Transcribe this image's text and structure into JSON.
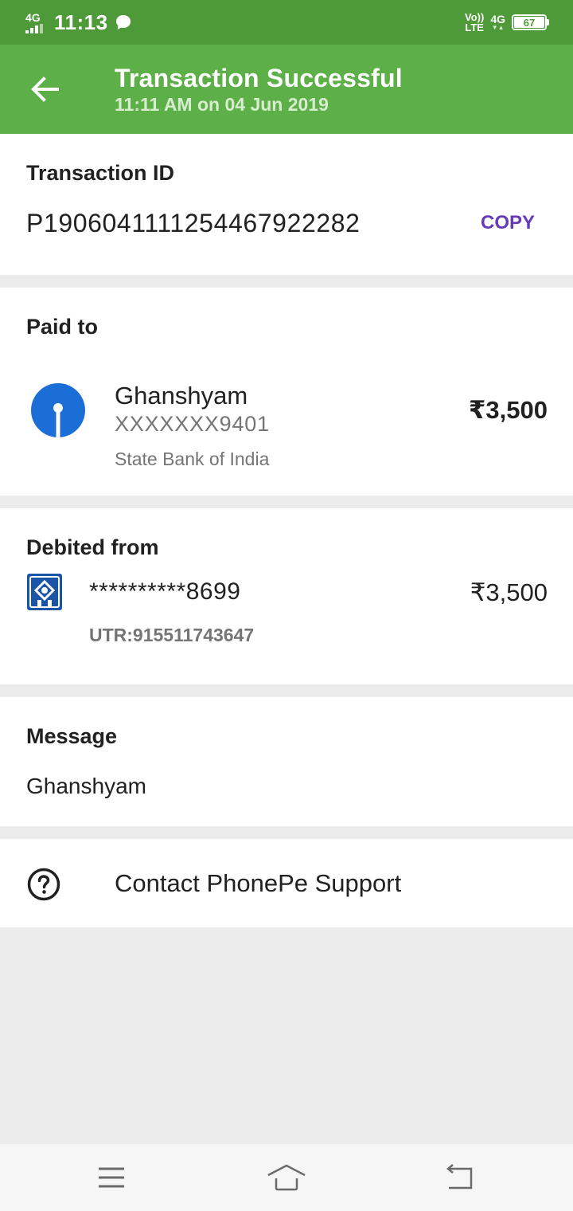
{
  "status_bar": {
    "network_left": "4G",
    "time": "11:13",
    "volte_top": "Vo))",
    "volte_bottom": "LTE",
    "network_right": "4G",
    "battery_level": "67"
  },
  "header": {
    "title": "Transaction Successful",
    "subtitle": "11:11 AM on 04 Jun 2019"
  },
  "transaction": {
    "label": "Transaction ID",
    "id": "P1906041111254467922282",
    "copy_label": "COPY"
  },
  "paid_to": {
    "label": "Paid to",
    "name": "Ghanshyam",
    "account": "XXXXXXX9401",
    "bank": "State Bank of India",
    "amount": "₹3,500"
  },
  "debited_from": {
    "label": "Debited from",
    "account": "**********8699",
    "utr": "UTR:915511743647",
    "amount": "₹3,500"
  },
  "message": {
    "label": "Message",
    "text": "Ghanshyam"
  },
  "support": {
    "label": "Contact PhonePe Support"
  },
  "colors": {
    "status_bar": "#4e9a38",
    "app_bar": "#5daf47",
    "accent": "#673ab7",
    "sbi_blue": "#1b6ed6",
    "bank_blue": "#1b56a6"
  },
  "icons": {
    "back": "arrow-left-icon",
    "chat": "chat-bubble-icon",
    "help": "help-circle-icon",
    "nav_menu": "menu-icon",
    "nav_home": "home-icon",
    "nav_back": "return-icon"
  }
}
